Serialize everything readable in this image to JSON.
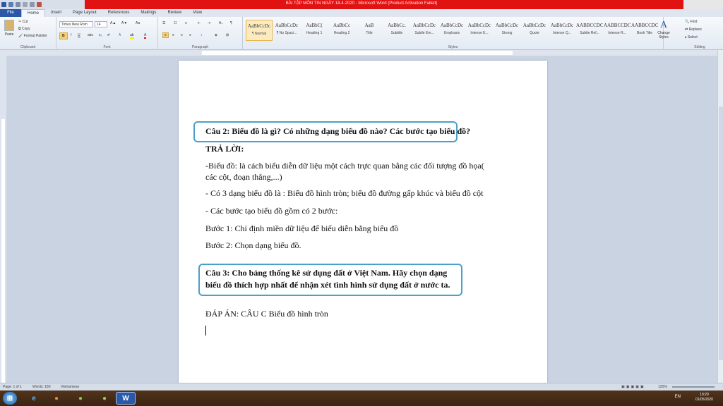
{
  "window": {
    "title": "BÀI TẬP MÔN TIN NGÀY 18-4-2020 - Microsoft Word (Product Activation Failed)"
  },
  "ribbon": {
    "tabs": [
      "File",
      "Home",
      "Insert",
      "Page Layout",
      "References",
      "Mailings",
      "Review",
      "View"
    ],
    "active_tab": "Home",
    "clipboard": {
      "paste": "Paste",
      "cut": "Cut",
      "copy": "Copy",
      "format_painter": "Format Painter",
      "label": "Clipboard"
    },
    "font": {
      "name": "Times New Rom",
      "size": "14",
      "label": "Font"
    },
    "paragraph": {
      "label": "Paragraph"
    },
    "styles": {
      "label": "Styles",
      "items": [
        {
          "sample": "AaBbCcDc",
          "name": "¶ Normal"
        },
        {
          "sample": "AaBbCcDc",
          "name": "¶ No Spaci..."
        },
        {
          "sample": "AaBbC(",
          "name": "Heading 1"
        },
        {
          "sample": "AaBbCc",
          "name": "Heading 2"
        },
        {
          "sample": "AaB",
          "name": "Title"
        },
        {
          "sample": "AaBbCc.",
          "name": "Subtitle"
        },
        {
          "sample": "AaBbCcDc",
          "name": "Subtle Em..."
        },
        {
          "sample": "AaBbCcDc",
          "name": "Emphasis"
        },
        {
          "sample": "AaBbCcDc",
          "name": "Intense E..."
        },
        {
          "sample": "AaBbCcDc",
          "name": "Strong"
        },
        {
          "sample": "AaBbCcDc",
          "name": "Quote"
        },
        {
          "sample": "AaBbCcDc",
          "name": "Intense Q..."
        },
        {
          "sample": "AABBCCDC",
          "name": "Subtle Ref..."
        },
        {
          "sample": "AABBCCDC",
          "name": "Intense R..."
        },
        {
          "sample": "AABBCCDC",
          "name": "Book Title"
        }
      ],
      "change_styles": "Change Styles"
    },
    "editing": {
      "find": "Find",
      "replace": "Replace",
      "select": "Select",
      "label": "Editing"
    }
  },
  "document": {
    "q2": "Câu 2: Biểu đồ là gì? Có những dạng biểu đồ nào? Các bước tạo biểu đồ?",
    "answer_heading": "TRẢ LỜI:",
    "line1": "-Biểu đồ: là cách biểu diễn dữ liệu một cách trực quan bằng các đối tượng đồ họa(",
    "line2": "các cột, đoạn thẳng,...)",
    "line3": "- Có 3 dạng biểu đồ là : Biểu đồ hình tròn; biểu đồ đường gấp khúc và biểu đồ cột",
    "line4": "- Các bước tạo biểu đồ gồm có 2 bước:",
    "step1": "Bước 1: Chỉ định miền dữ liệu để biểu diễn bằng biểu đồ",
    "step2": "Bước 2: Chọn dạng biểu đồ.",
    "q3_line1": "Câu 3: Cho bảng thống kê sử dụng đất ở Việt Nam. Hãy chọn dạng",
    "q3_line2": "biểu đồ thích hợp nhất để nhận xét tình hình sử dụng đất ở nước ta.",
    "answer": "ĐÁP ÁN: CÂU C Biểu đồ hình tròn"
  },
  "statusbar": {
    "page": "Page: 1 of 1",
    "words": "Words: 180",
    "language": "Vietnamese",
    "zoom": "120%"
  },
  "taskbar": {
    "lang": "EN",
    "time": "19:20",
    "date": "01/05/2020"
  },
  "colors": {
    "titlebar": "#e11212",
    "callout_border": "#4aa0c8",
    "file_tab": "#2b58a8"
  }
}
